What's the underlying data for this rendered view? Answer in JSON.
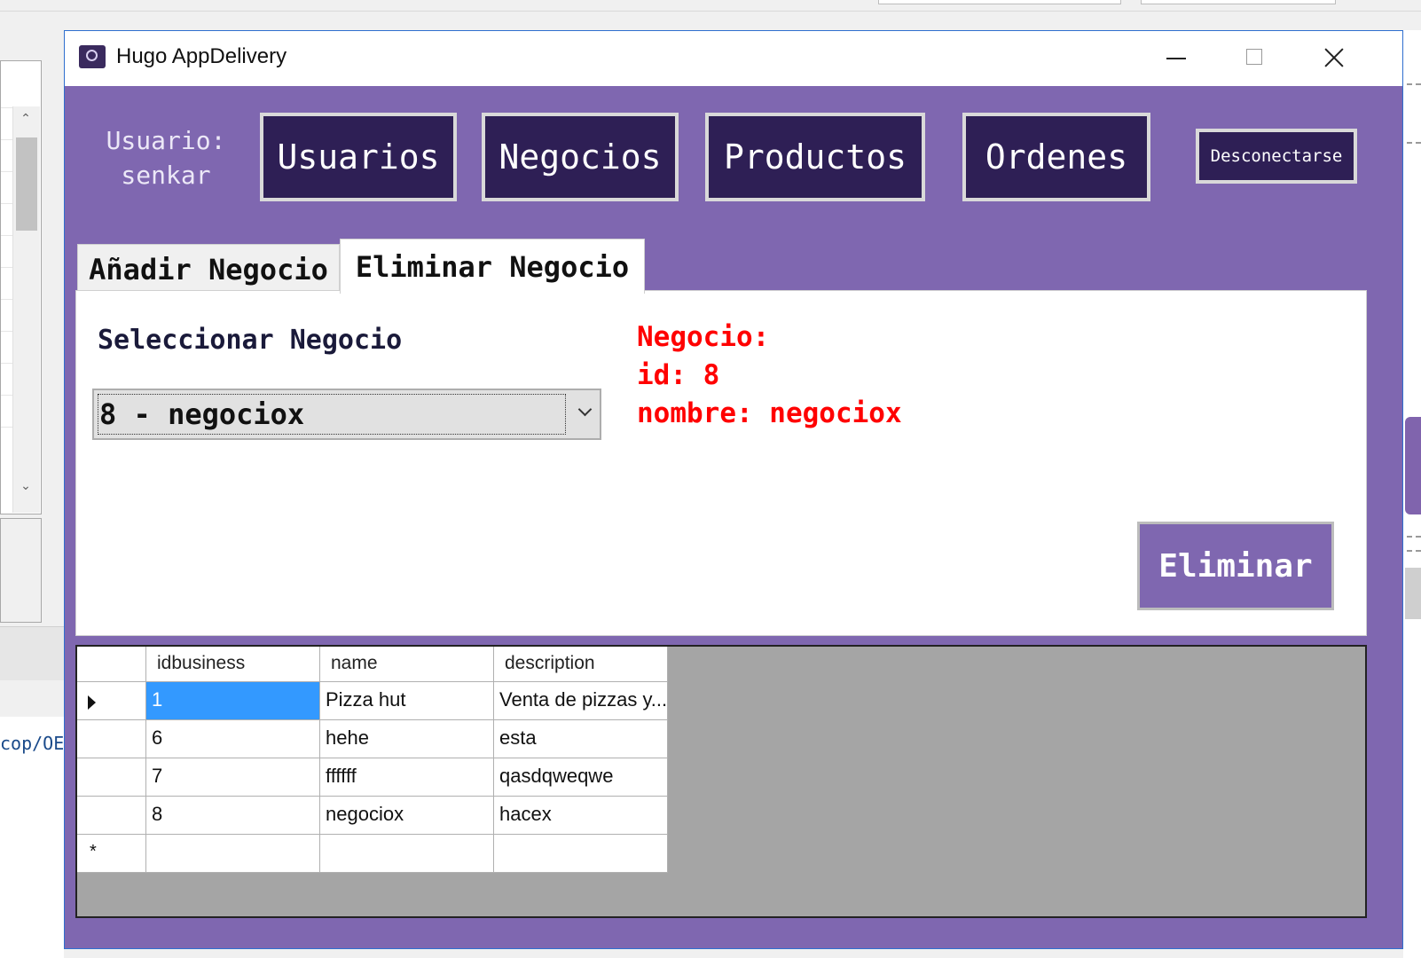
{
  "background": {
    "code_snippet": "cop/OE"
  },
  "window": {
    "title": "Hugo AppDelivery",
    "accent_color": "#7f67b0",
    "dark_button_color": "#2e1f55"
  },
  "header": {
    "user_prefix": "Usuario:",
    "username": "senkar",
    "nav": [
      "Usuarios",
      "Negocios",
      "Productos",
      "Ordenes"
    ],
    "logout": "Desconectarse"
  },
  "tabs": [
    {
      "label": "Añadir Negocio",
      "active": false
    },
    {
      "label": "Eliminar Negocio",
      "active": true
    }
  ],
  "panel": {
    "select_label": "Seleccionar Negocio",
    "selected_value": "8 - negociox",
    "info_line1": "Negocio:",
    "info_line2": "id: 8",
    "info_line3": "nombre: negociox",
    "delete_button": "Eliminar"
  },
  "grid": {
    "columns": [
      "idbusiness",
      "name",
      "description"
    ],
    "rows": [
      [
        "1",
        "Pizza hut",
        "Venta de pizzas y..."
      ],
      [
        "6",
        "hehe",
        "esta"
      ],
      [
        "7",
        "ffffff",
        "qasdqweqwe"
      ],
      [
        "8",
        "negociox",
        "hacex"
      ]
    ],
    "selected_row": 0
  }
}
